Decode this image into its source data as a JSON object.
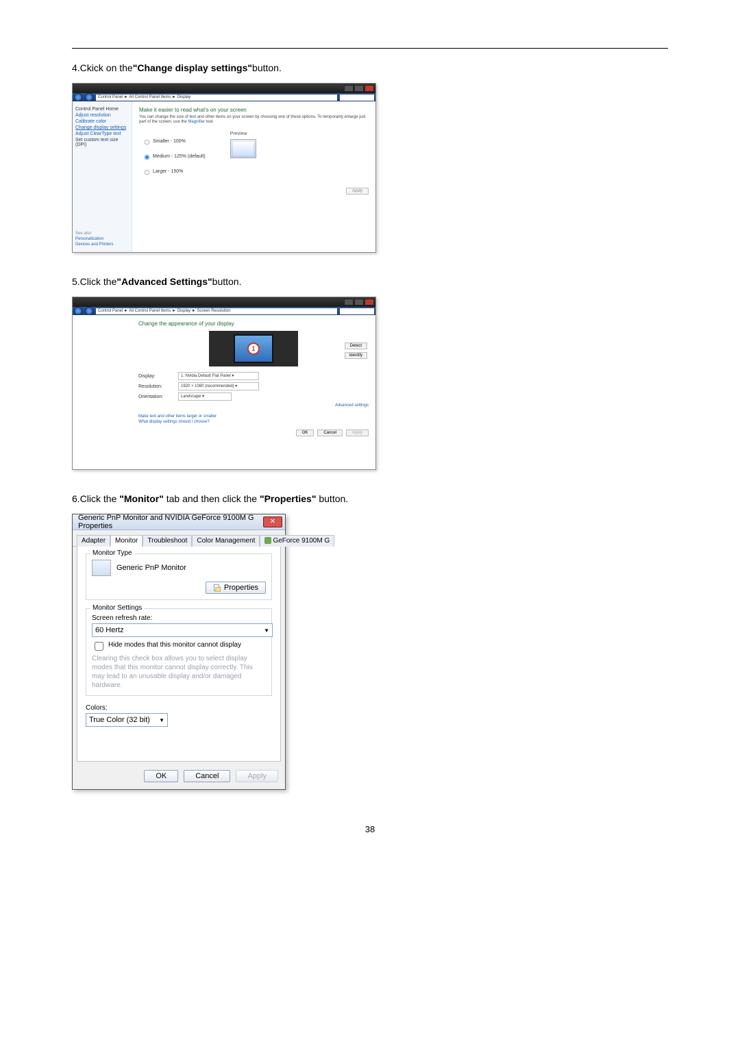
{
  "page_number": "38",
  "step4": {
    "text_prefix": "4.Ckick on the",
    "text_bold": "\"Change display settings\"",
    "text_suffix": "button."
  },
  "shot1": {
    "breadcrumb": "Control Panel  ►  All Control Panel Items  ►  Display",
    "sidebar": {
      "home": "Control Panel Home",
      "items": [
        "Adjust resolution",
        "Calibrate color",
        "Change display settings",
        "Adjust ClearType text",
        "Set custom text size (DPI)"
      ],
      "see_also_header": "See also",
      "see_also": [
        "Personalization",
        "Devices and Printers"
      ]
    },
    "main": {
      "heading": "Make it easier to read what's on your screen",
      "desc_a": "You can change the size of text and other items on your screen by choosing one of these options. To temporarily enlarge just part of the screen, use the ",
      "desc_link": "Magnifier",
      "desc_b": " tool.",
      "options": [
        "Smaller - 100%",
        "Medium - 125% (default)",
        "Larger - 150%"
      ],
      "preview_label": "Preview",
      "apply_label": "Apply"
    }
  },
  "step5": {
    "text_prefix": "5.Click the",
    "text_bold": "\"Advanced Settings\"",
    "text_suffix": "button."
  },
  "shot2": {
    "breadcrumb": "Control Panel  ►  All Control Panel Items  ►  Display  ►  Screen Resolution",
    "heading": "Change the appearance of your display",
    "detect": "Detect",
    "identify": "Identify",
    "monitor_digit": "1",
    "rows": {
      "display_label": "Display:",
      "display_value": "1. Nvidia Default Flat Panel  ▾",
      "resolution_label": "Resolution:",
      "resolution_value": "1920 × 1080 (recommended)  ▾",
      "orientation_label": "Orientation:",
      "orientation_value": "Landscape  ▾"
    },
    "advanced_link": "Advanced settings",
    "links": [
      "Make text and other items larger or smaller",
      "What display settings should I choose?"
    ],
    "buttons": {
      "ok": "OK",
      "cancel": "Cancel",
      "apply": "Apply"
    }
  },
  "step6": {
    "text_a": "6.Click the ",
    "bold_a": "\"Monitor\"",
    "text_b": " tab and then click the ",
    "bold_b": "\"Properties\"",
    "text_c": " button."
  },
  "shot3": {
    "title": "Generic PnP Monitor and NVIDIA GeForce 9100M G   Properties",
    "tabs": [
      "Adapter",
      "Monitor",
      "Troubleshoot",
      "Color Management",
      "GeForce 9100M G"
    ],
    "active_tab_index": 1,
    "monitor_type_group": "Monitor Type",
    "monitor_name": "Generic PnP Monitor",
    "properties_button": "Properties",
    "monitor_settings_group": "Monitor Settings",
    "refresh_label": "Screen refresh rate:",
    "refresh_value": "60 Hertz",
    "hide_modes_label": "Hide modes that this monitor cannot display",
    "hide_modes_hint": "Clearing this check box allows you to select display modes that this monitor cannot display correctly. This may lead to an unusable display and/or damaged hardware.",
    "colors_label": "Colors:",
    "colors_value": "True Color (32 bit)",
    "buttons": {
      "ok": "OK",
      "cancel": "Cancel",
      "apply": "Apply"
    }
  }
}
